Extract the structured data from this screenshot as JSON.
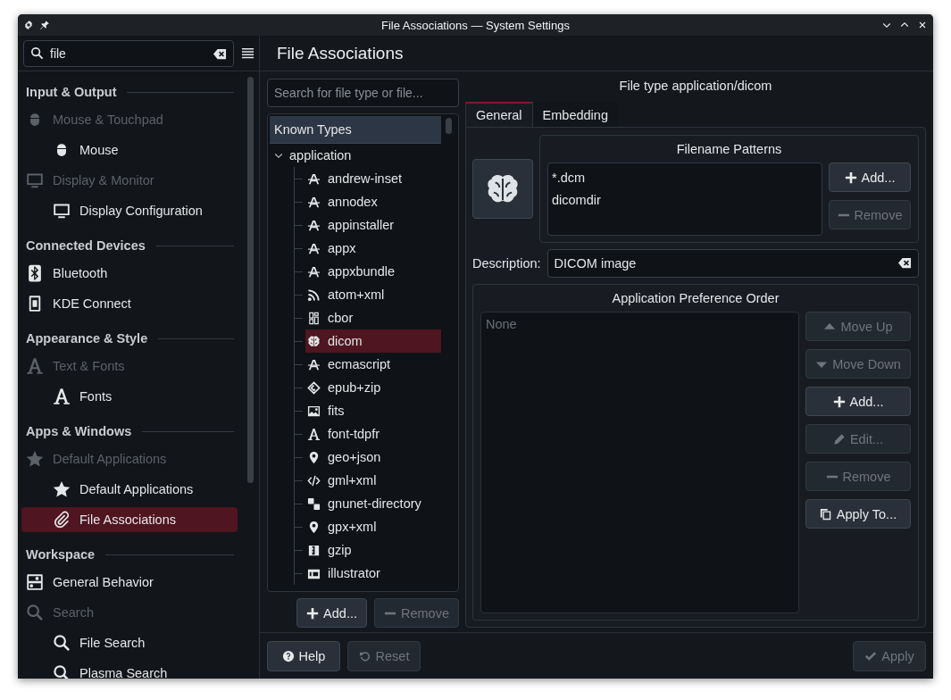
{
  "window": {
    "title": "File Associations — System Settings"
  },
  "sidebar": {
    "search": {
      "value": "file"
    },
    "sections": [
      {
        "title": "Input & Output",
        "items": [
          {
            "label": "Mouse & Touchpad",
            "kind": "category",
            "selected": false,
            "children": [
              {
                "label": "Mouse",
                "selected": false
              }
            ]
          },
          {
            "label": "Display & Monitor",
            "kind": "category",
            "selected": false,
            "children": [
              {
                "label": "Display Configuration",
                "selected": false
              }
            ]
          }
        ]
      },
      {
        "title": "Connected Devices",
        "items": [
          {
            "label": "Bluetooth",
            "kind": "page",
            "selected": false
          },
          {
            "label": "KDE Connect",
            "kind": "page",
            "selected": false
          }
        ]
      },
      {
        "title": "Appearance & Style",
        "items": [
          {
            "label": "Text & Fonts",
            "kind": "category",
            "selected": false,
            "children": [
              {
                "label": "Fonts",
                "selected": false
              }
            ]
          }
        ]
      },
      {
        "title": "Apps & Windows",
        "items": [
          {
            "label": "Default Applications",
            "kind": "category",
            "selected": false,
            "children": [
              {
                "label": "Default Applications",
                "selected": false
              },
              {
                "label": "File Associations",
                "selected": true
              }
            ]
          }
        ]
      },
      {
        "title": "Workspace",
        "items": [
          {
            "label": "General Behavior",
            "kind": "page",
            "selected": false
          },
          {
            "label": "Search",
            "kind": "category",
            "selected": false,
            "children": [
              {
                "label": "File Search",
                "selected": false
              },
              {
                "label": "Plasma Search",
                "selected": false
              }
            ]
          }
        ]
      }
    ]
  },
  "page_title": "File Associations",
  "type_search": {
    "placeholder": "Search for file type or file..."
  },
  "tree": {
    "header": "Known Types",
    "nodes": [
      {
        "label": "application",
        "expanded": true,
        "selected": false,
        "children": [
          {
            "label": "andrew-inset",
            "selected": false
          },
          {
            "label": "annodex",
            "selected": false
          },
          {
            "label": "appinstaller",
            "selected": false
          },
          {
            "label": "appx",
            "selected": false
          },
          {
            "label": "appxbundle",
            "selected": false
          },
          {
            "label": "atom+xml",
            "selected": false
          },
          {
            "label": "cbor",
            "selected": false
          },
          {
            "label": "dicom",
            "selected": true
          },
          {
            "label": "ecmascript",
            "selected": false
          },
          {
            "label": "epub+zip",
            "selected": false
          },
          {
            "label": "fits",
            "selected": false
          },
          {
            "label": "font-tdpfr",
            "selected": false
          },
          {
            "label": "geo+json",
            "selected": false
          },
          {
            "label": "gml+xml",
            "selected": false
          },
          {
            "label": "gnunet-directory",
            "selected": false
          },
          {
            "label": "gpx+xml",
            "selected": false
          },
          {
            "label": "gzip",
            "selected": false
          },
          {
            "label": "illustrator",
            "selected": false
          }
        ]
      }
    ]
  },
  "tree_buttons": [
    {
      "label": "Add...",
      "disabled": false
    },
    {
      "label": "Remove",
      "disabled": true
    }
  ],
  "details": {
    "title": "File type application/dicom",
    "tabs": [
      {
        "label": "General",
        "selected": true
      },
      {
        "label": "Embedding",
        "selected": false
      }
    ],
    "patterns": {
      "title": "Filename Patterns",
      "items": [
        "*.dcm",
        "dicomdir"
      ],
      "buttons": [
        {
          "label": "Add...",
          "disabled": false
        },
        {
          "label": "Remove",
          "disabled": true
        }
      ]
    },
    "description": {
      "label": "Description:",
      "value": "DICOM image"
    },
    "preference": {
      "title": "Application Preference Order",
      "empty_text": "None",
      "buttons": [
        {
          "label": "Move Up",
          "disabled": true
        },
        {
          "label": "Move Down",
          "disabled": true
        },
        {
          "label": "Add...",
          "disabled": false
        },
        {
          "label": "Edit...",
          "disabled": true
        },
        {
          "label": "Remove",
          "disabled": true
        },
        {
          "label": "Apply To...",
          "disabled": false
        }
      ]
    }
  },
  "footer": {
    "buttons": [
      {
        "label": "Help",
        "disabled": false
      },
      {
        "label": "Reset",
        "disabled": true
      },
      {
        "label": "Apply",
        "disabled": true
      }
    ]
  }
}
